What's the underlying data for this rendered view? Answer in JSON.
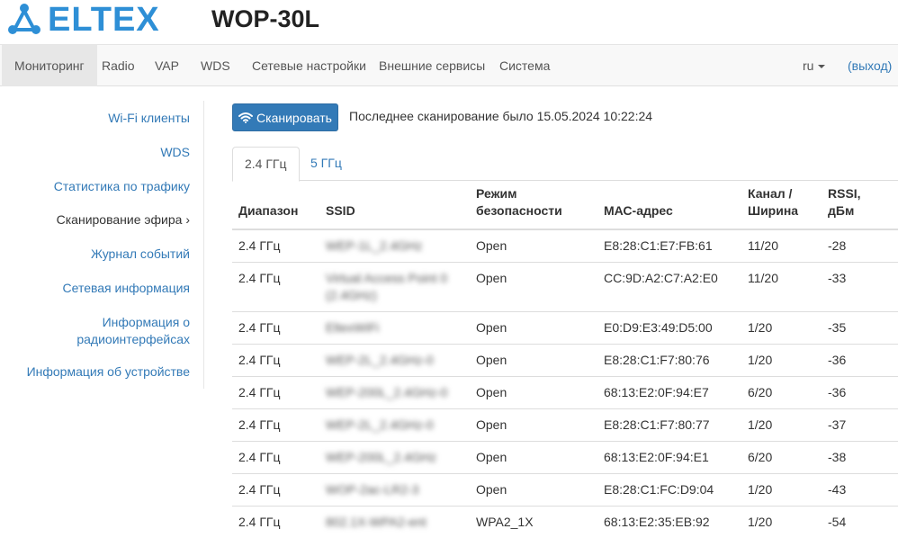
{
  "brand": {
    "logo_text": "ELTEX",
    "model": "WOP-30L",
    "accent": "#2e8fd6"
  },
  "nav": {
    "items": [
      "Мониторинг",
      "Radio",
      "VAP",
      "WDS",
      "Сетевые настройки",
      "Внешние сервисы",
      "Система"
    ],
    "lang": "ru",
    "logout": "(выход)"
  },
  "sidebar": {
    "items": [
      "Wi-Fi клиенты",
      "WDS",
      "Статистика по трафику",
      "Сканирование эфира ›",
      "Журнал событий",
      "Сетевая информация",
      "Информация о",
      "радиоинтерфейсах",
      "Информация об устройстве"
    ]
  },
  "scan": {
    "button_label": "Сканировать",
    "last_scan": "Последнее сканирование было 15.05.2024 10:22:24"
  },
  "tabs": [
    "2.4 ГГц",
    "5 ГГц"
  ],
  "table": {
    "headers": [
      "Диапазон",
      "SSID",
      "Режим",
      "безопасности",
      "МАС-адрес",
      "Канал /",
      "Ширина",
      "RSSI,",
      "дБм"
    ],
    "rows": [
      [
        "2.4 ГГц",
        "WEP-1L_2.4GHz",
        "Open",
        "E8:28:C1:E7:FB:61",
        "11/20",
        "-28"
      ],
      [
        "2.4 ГГц",
        "Virtual Access Point 0 (2.4GHz)",
        "Open",
        "CC:9D:A2:C7:A2:E0",
        "11/20",
        "-33"
      ],
      [
        "2.4 ГГц",
        "EltexWiFi",
        "Open",
        "E0:D9:E3:49:D5:00",
        "1/20",
        "-35"
      ],
      [
        "2.4 ГГц",
        "WEP-2L_2.4GHz-0",
        "Open",
        "E8:28:C1:F7:80:76",
        "1/20",
        "-36"
      ],
      [
        "2.4 ГГц",
        "WEP-200L_2.4GHz-0",
        "Open",
        "68:13:E2:0F:94:E7",
        "6/20",
        "-36"
      ],
      [
        "2.4 ГГц",
        "WEP-2L_2.4GHz-0",
        "Open",
        "E8:28:C1:F7:80:77",
        "1/20",
        "-37"
      ],
      [
        "2.4 ГГц",
        "WEP-200L_2.4GHz",
        "Open",
        "68:13:E2:0F:94:E1",
        "6/20",
        "-38"
      ],
      [
        "2.4 ГГц",
        "WOP-2ac-LR2-3",
        "Open",
        "E8:28:C1:FC:D9:04",
        "1/20",
        "-43"
      ],
      [
        "2.4 ГГц",
        "802.1X-WPA2-ent",
        "WPA2_1X",
        "68:13:E2:35:EB:92",
        "1/20",
        "-54"
      ]
    ]
  }
}
